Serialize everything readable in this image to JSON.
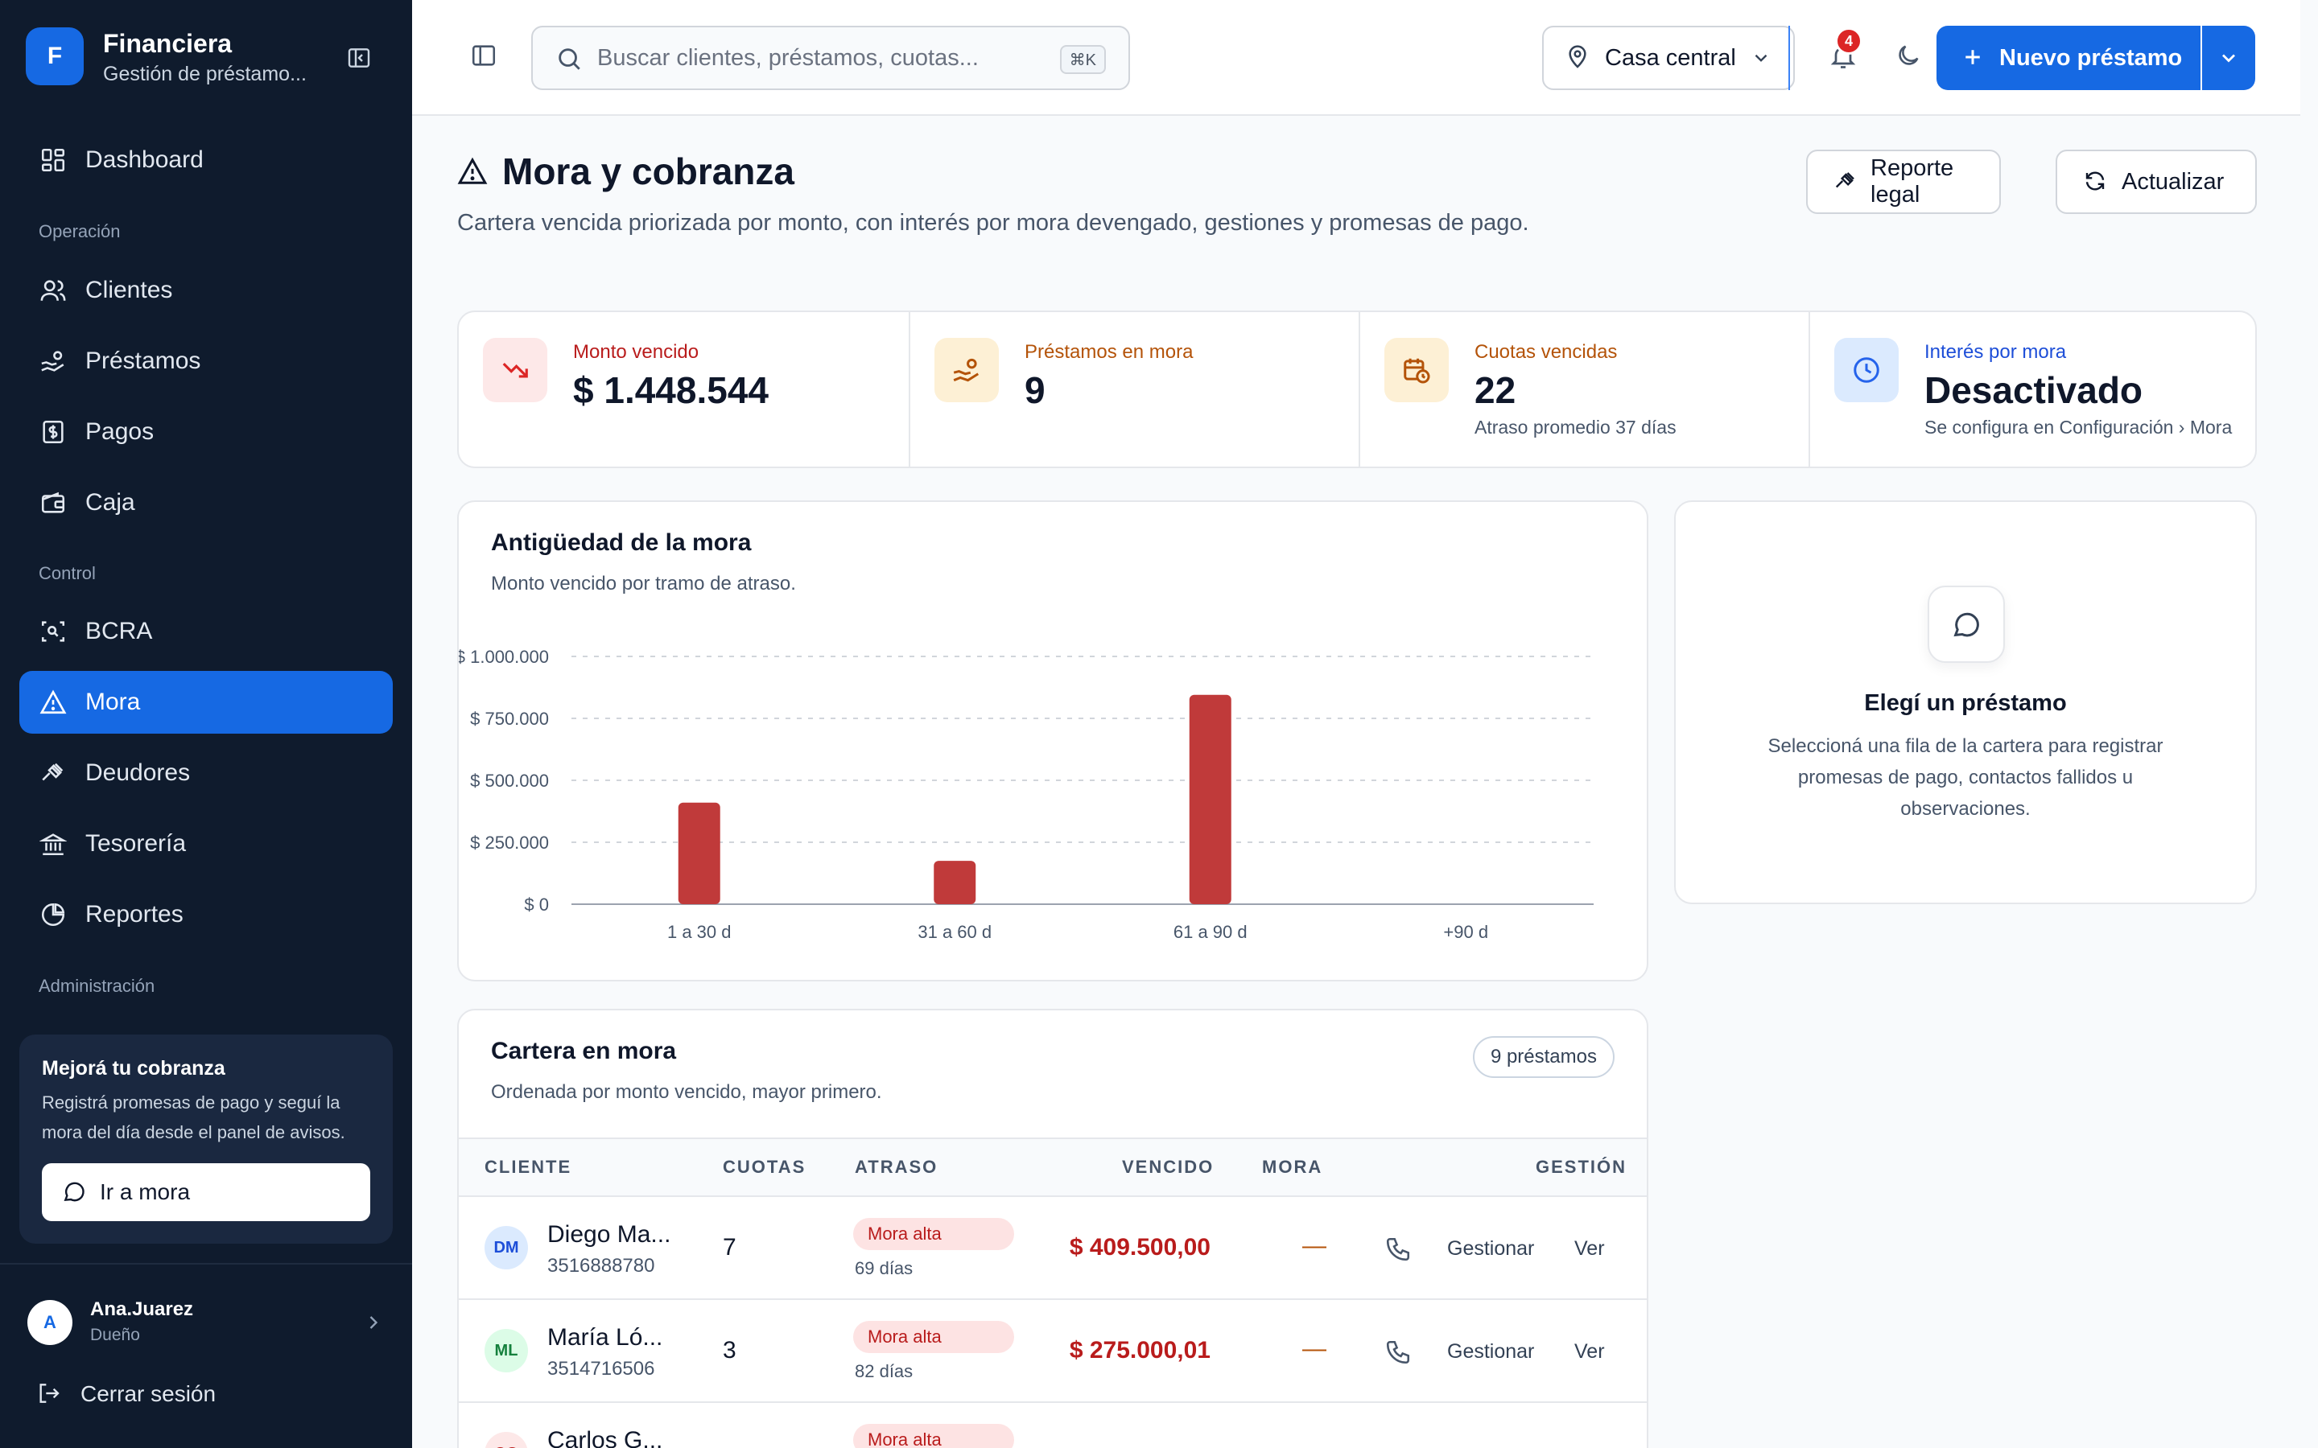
{
  "brand": {
    "logo_letter": "F",
    "name": "Financiera",
    "subtitle": "Gestión de préstamo..."
  },
  "sidebar": {
    "dashboard": "Dashboard",
    "section_operacion": "Operación",
    "clientes": "Clientes",
    "prestamos": "Préstamos",
    "pagos": "Pagos",
    "caja": "Caja",
    "section_control": "Control",
    "bcra": "BCRA",
    "mora": "Mora",
    "deudores": "Deudores",
    "tesoreria": "Tesorería",
    "reportes": "Reportes",
    "section_admin": "Administración",
    "active_item": "Mora"
  },
  "promo": {
    "title": "Mejorá tu cobranza",
    "text": "Registrá promesas de pago y seguí la mora del día desde el panel de avisos.",
    "button": "Ir a mora"
  },
  "user": {
    "initial": "A",
    "name": "Ana.Juarez",
    "role": "Dueño",
    "logout": "Cerrar sesión"
  },
  "topbar": {
    "search_placeholder": "Buscar clientes, préstamos, cuotas...",
    "search_shortcut": "⌘K",
    "branch": "Casa central",
    "notifications_count": "4",
    "new_loan": "Nuevo préstamo"
  },
  "page": {
    "title": "Mora y cobranza",
    "subtitle": "Cartera vencida priorizada por monto, con interés por mora devengado, gestiones y promesas de pago.",
    "btn_report": "Reporte legal",
    "btn_refresh": "Actualizar"
  },
  "stats": [
    {
      "label": "Monto vencido",
      "value": "$ 1.448.544",
      "note": ""
    },
    {
      "label": "Préstamos en mora",
      "value": "9",
      "note": ""
    },
    {
      "label": "Cuotas vencidas",
      "value": "22",
      "note": "Atraso promedio 37 días"
    },
    {
      "label": "Interés por mora",
      "value": "Desactivado",
      "note": "Se configura en Configuración › Mora"
    }
  ],
  "colors": {
    "accent": "#1669e3",
    "sidebar_bg": "#0f1b2d",
    "danger": "#b91c1c",
    "bar": "#c03a3a",
    "warning": "#b45309",
    "info": "#2563eb"
  },
  "chart_card": {
    "title": "Antigüedad de la mora",
    "subtitle": "Monto vencido por tramo de atraso."
  },
  "chart_data": {
    "type": "bar",
    "categories": [
      "1 a 30 d",
      "31 a 60 d",
      "61 a 90 d",
      "+90 d"
    ],
    "values": [
      410000,
      175000,
      845000,
      0
    ],
    "yticks": [
      0,
      250000,
      500000,
      750000,
      1000000
    ],
    "ytick_labels": [
      "$ 0",
      "$ 250.000",
      "$ 500.000",
      "$ 750.000",
      "$ 1.000.000"
    ],
    "ylim": [
      0,
      1000000
    ],
    "grid": true,
    "bar_color": "#c03a3a"
  },
  "empty_panel": {
    "title": "Elegí un préstamo",
    "text": "Seleccioná una fila de la cartera para registrar promesas de pago, contactos fallidos u observaciones."
  },
  "table": {
    "title": "Cartera en mora",
    "subtitle": "Ordenada por monto vencido, mayor primero.",
    "count_badge": "9 préstamos",
    "headers": {
      "cliente": "CLIENTE",
      "cuotas": "CUOTAS",
      "atraso": "ATRASO",
      "vencido": "VENCIDO",
      "mora": "MORA",
      "gestion": "GESTIÓN"
    },
    "rows": [
      {
        "initials": "DM",
        "name": "Diego Ma...",
        "phone": "3516888780",
        "cuotas": "7",
        "risk": "Mora alta",
        "days": "69 días",
        "vencido": "$ 409.500,00",
        "mora": "—",
        "action_manage": "Gestionar",
        "action_view": "Ver"
      },
      {
        "initials": "ML",
        "name": "María Ló...",
        "phone": "3514716506",
        "cuotas": "3",
        "risk": "Mora alta",
        "days": "82 días",
        "vencido": "$ 275.000,01",
        "mora": "—",
        "action_manage": "Gestionar",
        "action_view": "Ver"
      },
      {
        "initials": "CG",
        "name": "Carlos G...",
        "phone": "",
        "cuotas": "",
        "risk": "Mora alta",
        "days": "",
        "vencido": "",
        "mora": "",
        "action_manage": "",
        "action_view": ""
      }
    ]
  }
}
